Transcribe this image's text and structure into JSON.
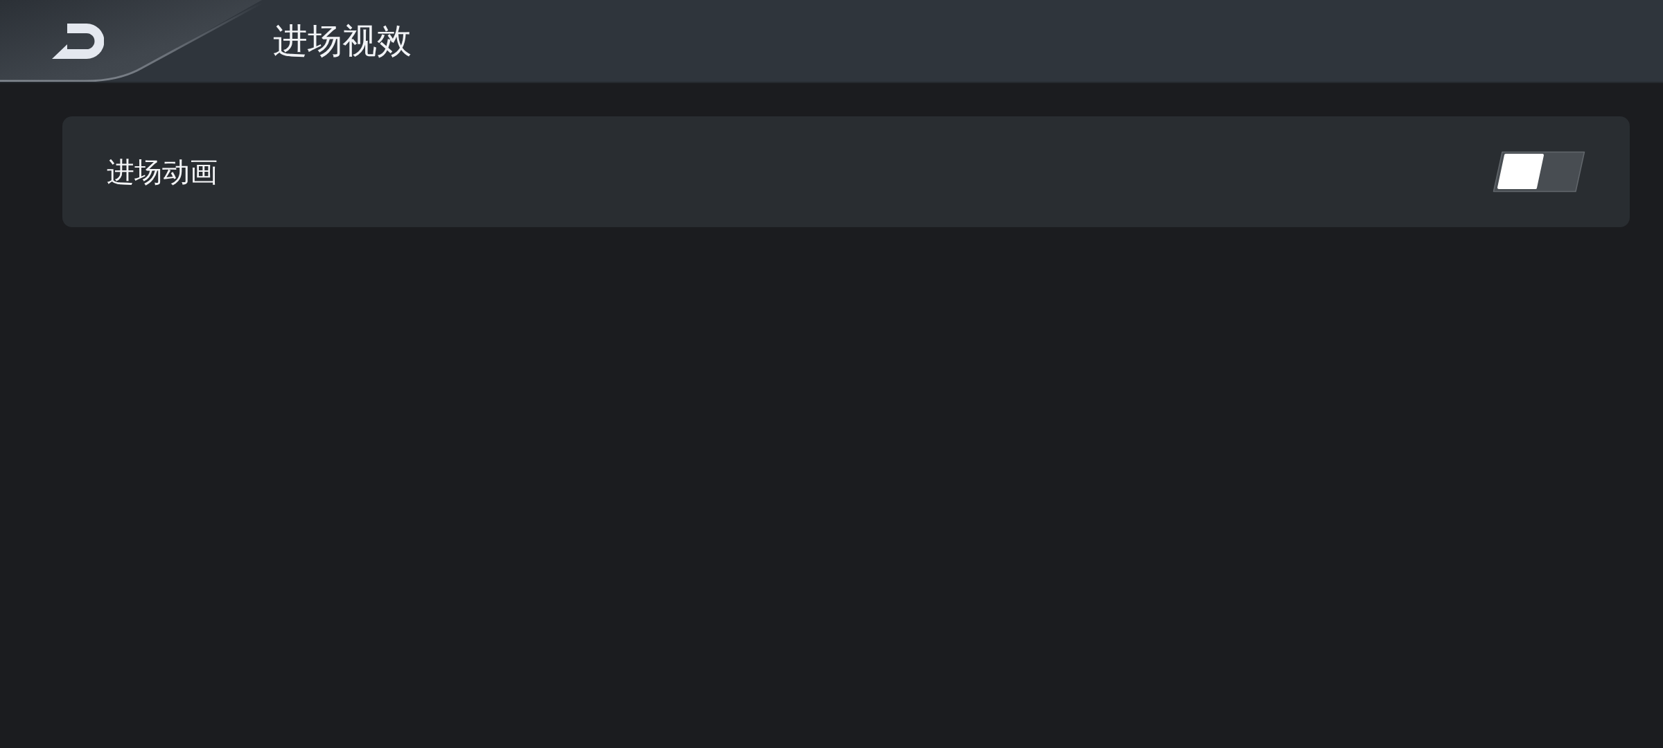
{
  "header": {
    "title": "进场视效"
  },
  "settings": [
    {
      "label": "进场动画",
      "on": false
    }
  ]
}
